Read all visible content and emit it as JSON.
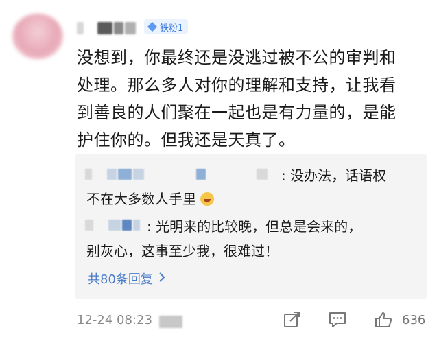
{
  "comment": {
    "badge_label": "铁粉1",
    "text_lines": [
      "没想到，你最终还是没逃过被不公的审判和",
      "处理。那么多人对你的理解和支持，让我看",
      "到善良的人们聚在一起也是有力量的，是能",
      "护住你的。但我还是天真了。"
    ]
  },
  "replies": [
    {
      "text_line1": ": 没办法，话语权",
      "text_line2": "不在大多数人手里"
    },
    {
      "text_line1": ": 光明来的比较晚，但总是会来的，",
      "text_line2": "别灰心，这事至少我，很难过！"
    }
  ],
  "replies_link": "共80条回复",
  "footer": {
    "timestamp": "12-24 08:23",
    "like_count": "636"
  },
  "icons": {
    "badge": "diamond-icon",
    "share": "share-icon",
    "comment": "comment-icon",
    "like": "thumbs-up-icon",
    "replies_chevron": "chevron-right-icon",
    "emoji": "laughing-emoji-icon"
  }
}
